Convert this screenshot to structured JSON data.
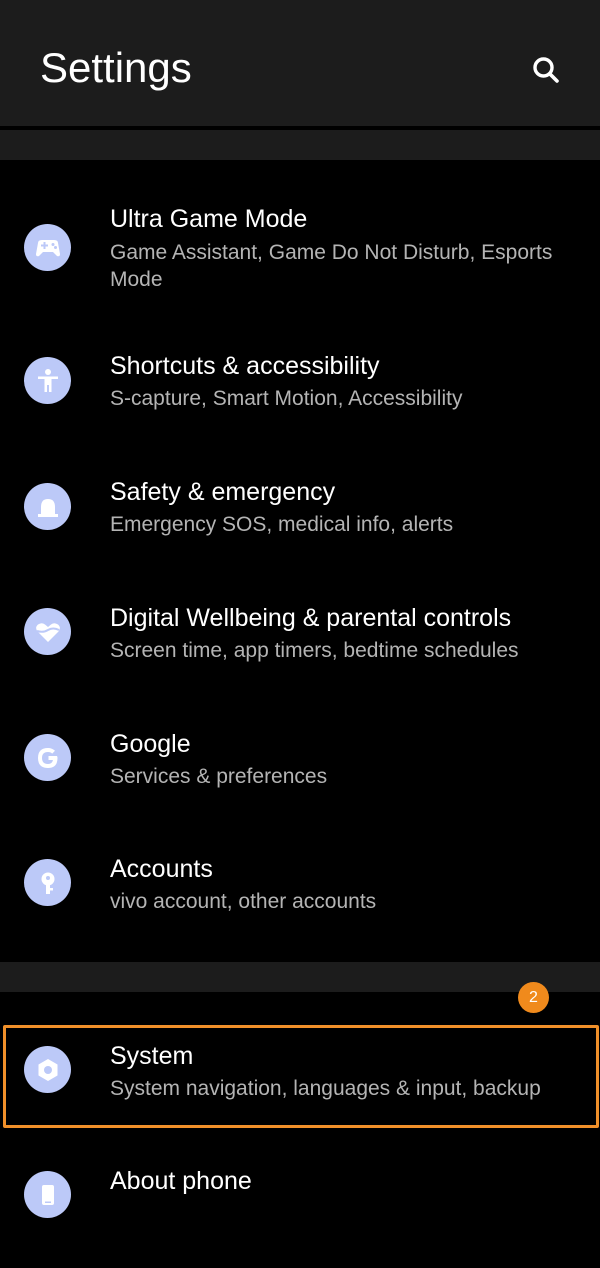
{
  "header": {
    "title": "Settings",
    "search_icon": "search-icon"
  },
  "items": [
    {
      "title": "Ultra Game Mode",
      "subtitle": "Game Assistant, Game Do Not Disturb, Esports Mode",
      "icon": "gamepad-icon"
    },
    {
      "title": "Shortcuts & accessibility",
      "subtitle": "S-capture, Smart Motion, Accessibility",
      "icon": "accessibility-icon"
    },
    {
      "title": "Safety & emergency",
      "subtitle": "Emergency SOS, medical info, alerts",
      "icon": "emergency-icon"
    },
    {
      "title": "Digital Wellbeing & parental controls",
      "subtitle": "Screen time, app timers, bedtime schedules",
      "icon": "heart-icon"
    },
    {
      "title": "Google",
      "subtitle": "Services & preferences",
      "icon": "google-icon"
    },
    {
      "title": "Accounts",
      "subtitle": "vivo account, other accounts",
      "icon": "key-icon"
    },
    {
      "title": "System",
      "subtitle": "System navigation, languages & input, backup",
      "icon": "system-icon"
    },
    {
      "title": "About phone",
      "subtitle": "",
      "icon": "phone-icon"
    }
  ],
  "annotation": {
    "badge_number": "2",
    "highlight_color": "#f0902a"
  },
  "colors": {
    "background": "#000000",
    "header_bg": "#1c1c1c",
    "icon_bg": "#bcc9f8",
    "title_text": "#ffffff",
    "subtitle_text": "#b4b4b4",
    "badge_bg": "#f08a1c"
  }
}
